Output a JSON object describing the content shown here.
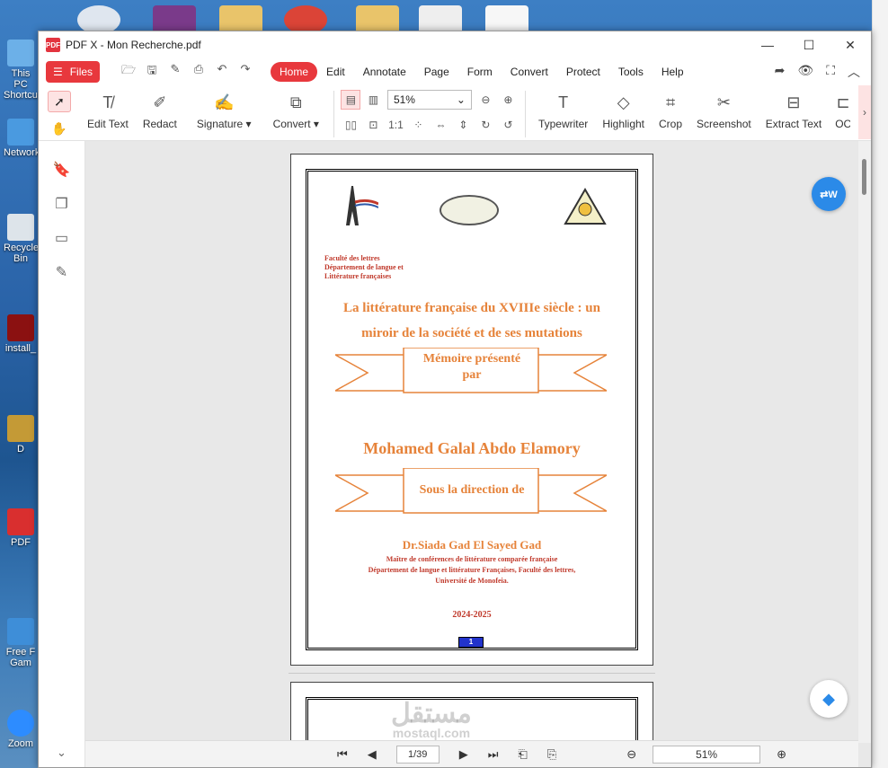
{
  "window": {
    "title": "PDF X - Mon Recherche.pdf",
    "logo_text": "PDF"
  },
  "desktop": {
    "icons": [
      {
        "label": "This PC",
        "sub": "Shortcut"
      },
      {
        "label": "Network"
      },
      {
        "label": "Recycle Bin"
      },
      {
        "label": "install_"
      },
      {
        "label": "D"
      },
      {
        "label": "PDF"
      },
      {
        "label": "Free F",
        "sub": "Gam"
      },
      {
        "label": "Zoom"
      }
    ]
  },
  "menubar": {
    "files_label": "Files",
    "menus": [
      "Home",
      "Edit",
      "Annotate",
      "Page",
      "Form",
      "Convert",
      "Protect",
      "Tools",
      "Help"
    ],
    "active_menu": "Home"
  },
  "ribbon": {
    "tools": [
      {
        "label": "Edit Text",
        "icon": "edit-text-icon"
      },
      {
        "label": "Redact",
        "icon": "redact-icon"
      },
      {
        "label": "Signature ▾",
        "icon": "signature-icon"
      },
      {
        "label": "Convert ▾",
        "icon": "convert-icon"
      }
    ],
    "zoom_value": "51%",
    "right_tools": [
      {
        "label": "Typewriter",
        "icon": "typewriter-icon"
      },
      {
        "label": "Highlight",
        "icon": "highlight-icon"
      },
      {
        "label": "Crop",
        "icon": "crop-icon"
      },
      {
        "label": "Screenshot",
        "icon": "screenshot-icon"
      },
      {
        "label": "Extract Text",
        "icon": "extract-text-icon"
      },
      {
        "label": "OC",
        "icon": "ocr-icon"
      }
    ]
  },
  "document": {
    "faculty": [
      "Faculté des lettres",
      "Département de langue et",
      "Littérature françaises"
    ],
    "title_line1": "La littérature française du XVIIIe siècle : un",
    "title_line2": "miroir de la société et de ses mutations",
    "banner1_line1": "Mémoire présenté",
    "banner1_line2": "par",
    "author": "Mohamed Galal Abdo Elamory",
    "banner2": "Sous la direction de",
    "director": "Dr.Siada Gad El Sayed Gad",
    "director_info": [
      "Maître de conférences de littérature comparée française",
      "Département de langue et littérature Françaises, Faculté des lettres,",
      "Université de Monofeia."
    ],
    "year": "2024-2025",
    "page_number": "1"
  },
  "statusbar": {
    "page_indicator": "1/39",
    "zoom": "51%"
  },
  "watermark": {
    "arabic": "مستقل",
    "latin": "mostaql.com"
  },
  "colors": {
    "accent": "#e8383d",
    "doc_orange": "#e6833a",
    "doc_red": "#c0392b"
  }
}
